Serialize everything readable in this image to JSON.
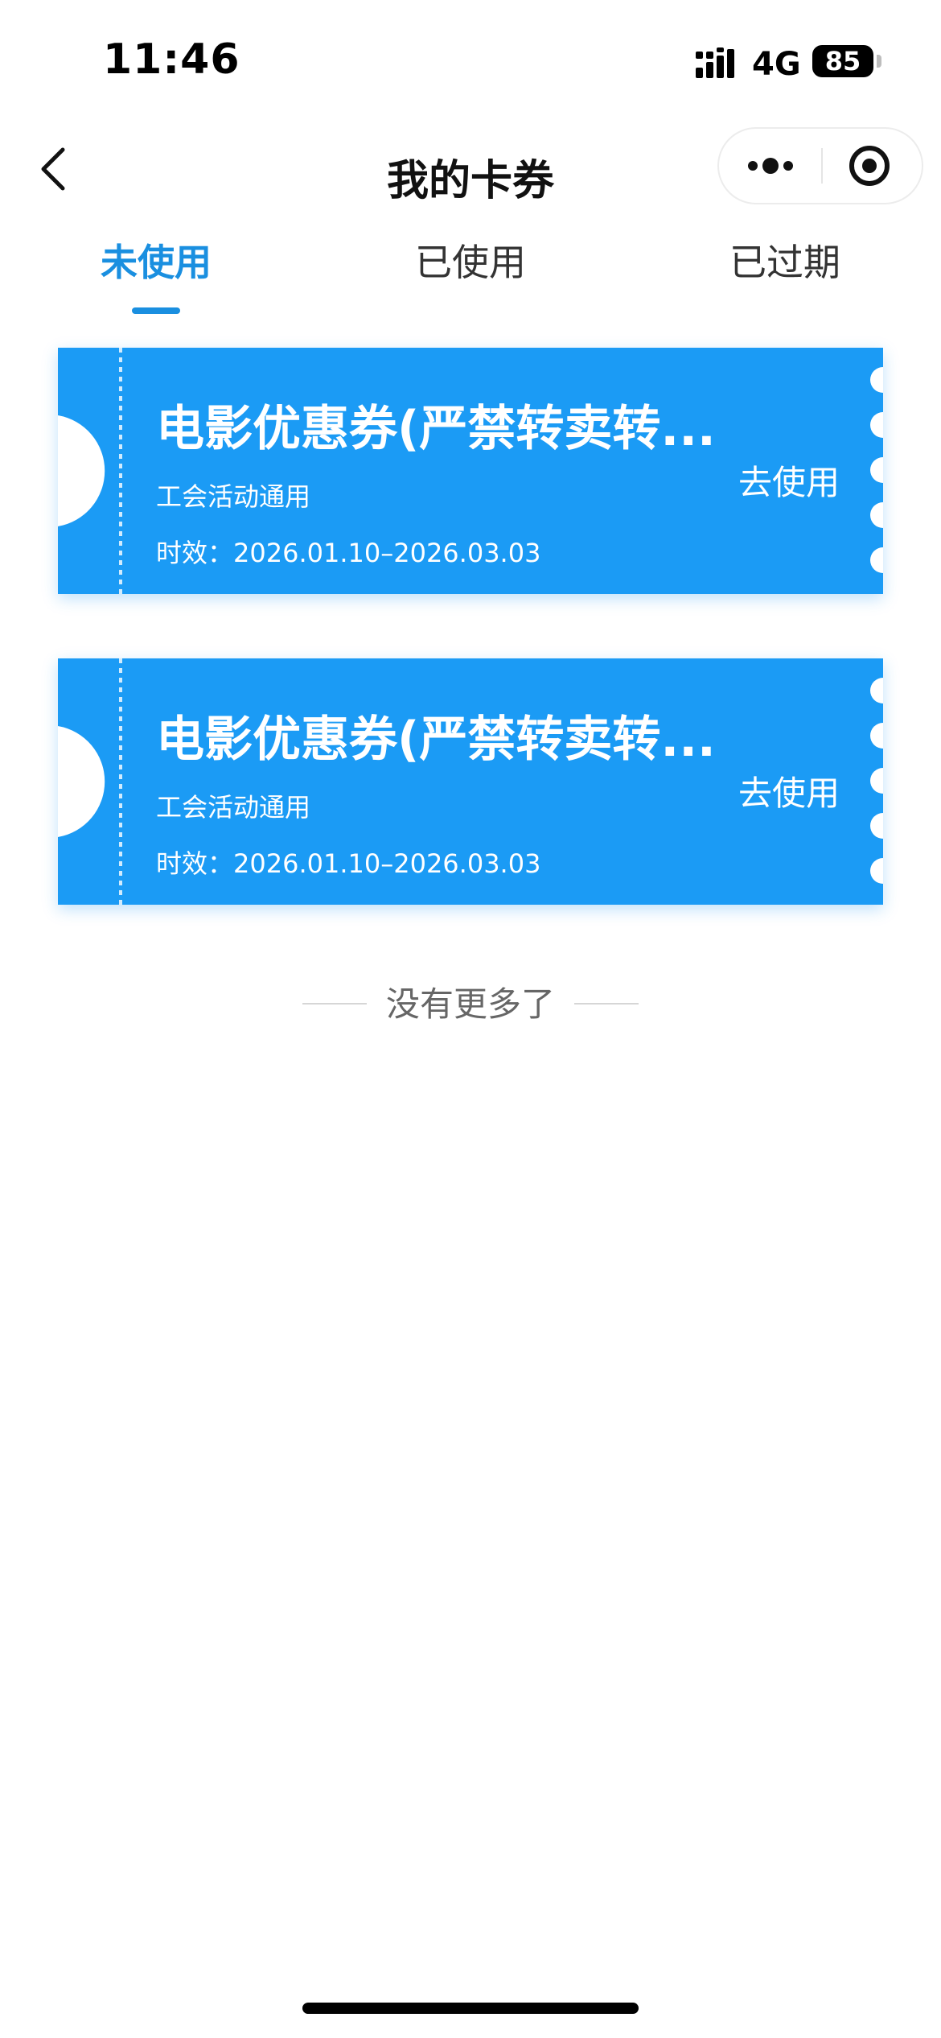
{
  "status_bar": {
    "time": "11:46",
    "network": "4G",
    "battery": "85"
  },
  "nav": {
    "title": "我的卡券",
    "back_icon": "chevron-left-icon",
    "more_icon": "more-dots-icon",
    "target_icon": "target-icon"
  },
  "tabs": [
    {
      "label": "未使用",
      "active": true
    },
    {
      "label": "已使用",
      "active": false
    },
    {
      "label": "已过期",
      "active": false
    }
  ],
  "coupons": [
    {
      "title": "电影优惠券(严禁转卖转...",
      "tag": "工会活动通用",
      "validity": "时效：2026.01.10–2026.03.03",
      "action": "去使用"
    },
    {
      "title": "电影优惠券(严禁转卖转...",
      "tag": "工会活动通用",
      "validity": "时效：2026.01.10–2026.03.03",
      "action": "去使用"
    }
  ],
  "end_note": "没有更多了",
  "colors": {
    "accent": "#1a8fe0",
    "coupon_bg": "#1b9bf5"
  }
}
